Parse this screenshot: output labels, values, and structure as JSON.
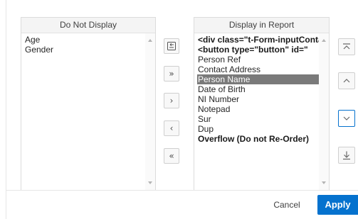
{
  "do_not_display": {
    "title": "Do Not Display",
    "items": [
      "Age",
      "Gender"
    ]
  },
  "display_in_report": {
    "title": "Display in Report",
    "items": [
      {
        "label": "<div class=\"t-Form-inputContainer",
        "bold": true
      },
      {
        "label": "<button type=\"button\" id=\"",
        "bold": true
      },
      {
        "label": "Person Ref",
        "bold": false
      },
      {
        "label": "Contact Address",
        "bold": false
      },
      {
        "label": "Person Name",
        "bold": false,
        "selected": true
      },
      {
        "label": "Date of Birth",
        "bold": false
      },
      {
        "label": "NI Number",
        "bold": false
      },
      {
        "label": "Notepad",
        "bold": false
      },
      {
        "label": "Sur",
        "bold": false
      },
      {
        "label": "Dup",
        "bold": false
      },
      {
        "label": "Overflow (Do not Re-Order)",
        "bold": true
      }
    ]
  },
  "move_buttons": {
    "reset": "reset-icon",
    "move_all": "»",
    "move": "›",
    "remove": "‹",
    "remove_all": "«"
  },
  "order_buttons": [
    "top-icon",
    "up-icon",
    "down-icon",
    "bottom-icon"
  ],
  "footer": {
    "cancel_label": "Cancel",
    "apply_label": "Apply"
  },
  "colors": {
    "accent": "#0572ce",
    "selected_bg": "#7a7a7a"
  }
}
